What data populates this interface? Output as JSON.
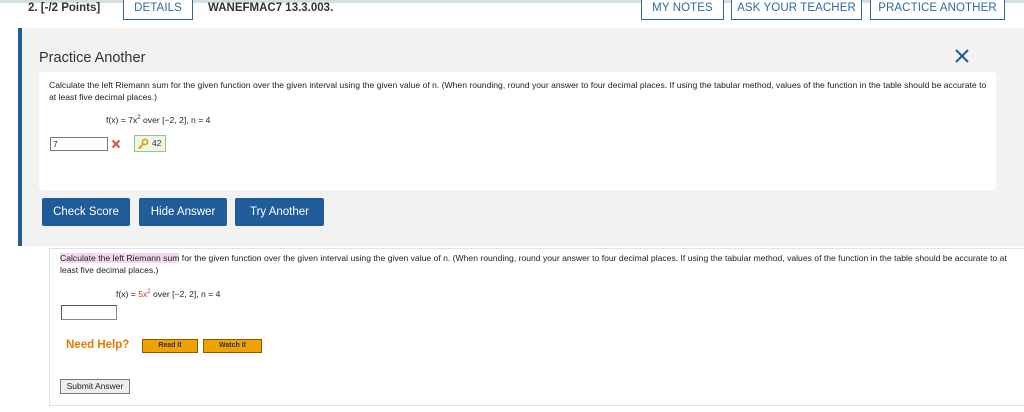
{
  "header": {
    "question_number": "2.  [-/2 Points]",
    "details_label": "DETAILS",
    "question_code": "WANEFMAC7 13.3.003.",
    "my_notes_label": "MY NOTES",
    "ask_teacher_label": "ASK YOUR TEACHER",
    "practice_another_label": "PRACTICE ANOTHER"
  },
  "practice": {
    "title": "Practice Another",
    "question_text": "Calculate the left Riemann sum for the given function over the given interval using the given value of n. (When rounding, round your answer to four decimal places. If using the tabular method, values of the function in the table should be accurate to at least five decimal places.)",
    "function_prefix": "f(x) = 7x",
    "function_exponent": "2",
    "function_suffix": " over [−2, 2], n = 4",
    "answer_value": "7",
    "correct_answer": "42",
    "check_score_label": "Check Score",
    "hide_answer_label": "Hide Answer",
    "try_another_label": "Try Another"
  },
  "main": {
    "highlight_text": "Calculate the left Riemann sum",
    "question_rest": " for the given function over the given interval using the given value of n. (When rounding, round your answer to four decimal places. If using the tabular method, values of the function in the table should be accurate to at least five decimal places.)",
    "function_prefix": "f(x) = ",
    "function_coefficient": "5x",
    "function_exponent": "2",
    "function_suffix": " over [−2, 2], n = 4",
    "answer_value": "",
    "need_help_label": "Need Help?",
    "read_it_label": "Read It",
    "watch_it_label": "Watch It",
    "submit_label": "Submit Answer"
  },
  "colors": {
    "accent_blue": "#1f5c99",
    "error_red": "#d9534f",
    "help_orange": "#e07b00",
    "highlight_pink": "#f2d7ef"
  },
  "icons": [
    "close-icon",
    "wrong-mark-icon",
    "key-icon"
  ]
}
